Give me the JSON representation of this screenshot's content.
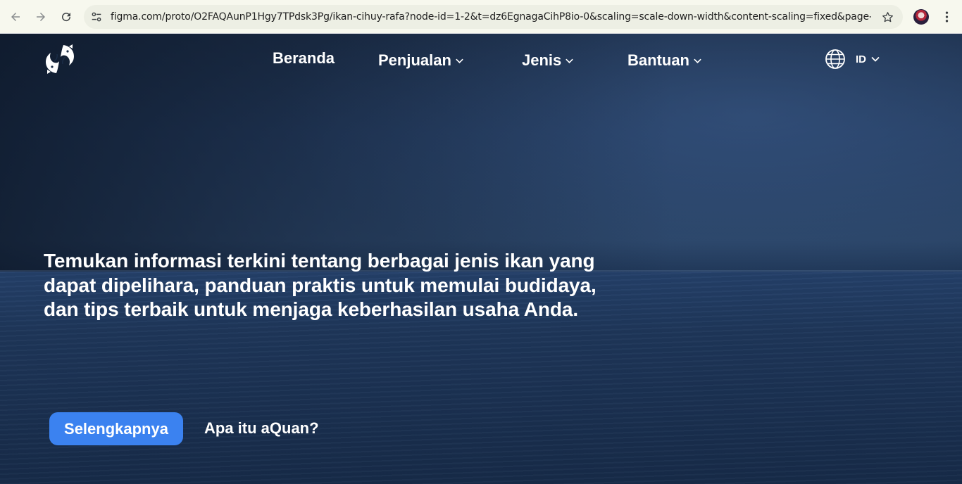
{
  "browser": {
    "url": "figma.com/proto/O2FAQAunP1Hgy7TPdsk3Pg/ikan-cihuy-rafa?node-id=1-2&t=dz6EgnagaCihP8io-0&scaling=scale-down-width&content-scaling=fixed&page-id=0%3A1&...",
    "icons": [
      "back-arrow-icon",
      "forward-arrow-icon",
      "reload-icon",
      "site-settings-icon",
      "bookmark-star-icon",
      "profile-avatar",
      "more-menu-icon"
    ]
  },
  "nav": {
    "items": [
      {
        "label": "Beranda",
        "has_dropdown": false
      },
      {
        "label": "Penjualan",
        "has_dropdown": true
      },
      {
        "label": "Jenis",
        "has_dropdown": true
      },
      {
        "label": "Bantuan",
        "has_dropdown": true
      }
    ],
    "language": {
      "code": "ID",
      "icon": "globe-icon"
    },
    "logo_icon": "twin-fish-logo"
  },
  "hero": {
    "headline": "Temukan informasi terkini tentang berbagai jenis ikan yang dapat dipelihara, panduan praktis untuk memulai budidaya, dan tips terbaik untuk menjaga keberhasilan usaha Anda.",
    "primary_button": "Selengkapnya",
    "secondary_link": "Apa itu aQuan?"
  },
  "colors": {
    "accent": "#3b82f0",
    "background": "#1e3659",
    "text": "#ffffff"
  }
}
